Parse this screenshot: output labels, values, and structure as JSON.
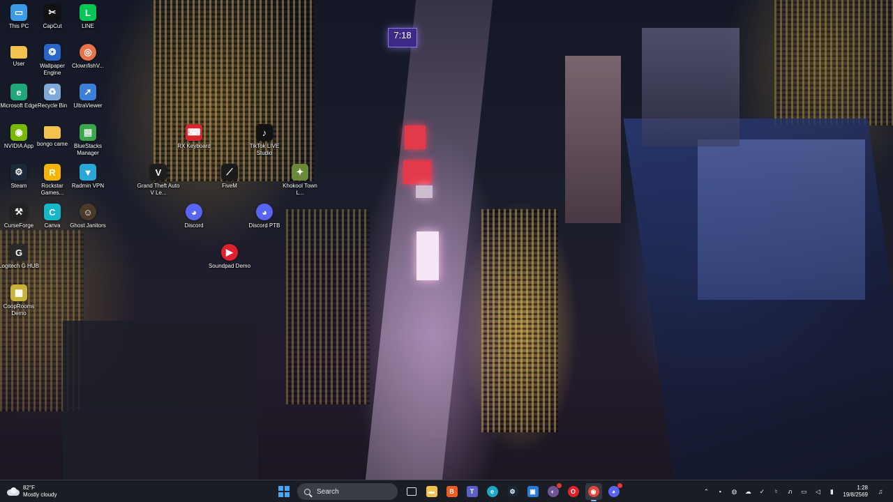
{
  "wallpaper": {
    "sign_time": "7:18"
  },
  "desktop_icons": [
    {
      "label": "This PC",
      "icon": "monitor-icon",
      "color": "#3a9be8",
      "glyph": "▭"
    },
    {
      "label": "User",
      "icon": "folder-icon",
      "color": "#f2c14e",
      "glyph": ""
    },
    {
      "label": "Microsoft Edge",
      "icon": "edge-icon",
      "color": "#1fa67a",
      "glyph": "e"
    },
    {
      "label": "NVIDIA App",
      "icon": "nvidia-icon",
      "color": "#76b900",
      "glyph": "◉"
    },
    {
      "label": "Steam",
      "icon": "steam-icon",
      "color": "#1b2838",
      "glyph": "⚙"
    },
    {
      "label": "CurseForge",
      "icon": "curseforge-icon",
      "color": "#222222",
      "glyph": "⚒"
    },
    {
      "label": "Logitech G HUB",
      "icon": "logitech-icon",
      "color": "#2a2a2a",
      "glyph": "G"
    },
    {
      "label": "CoopRooms Demo",
      "icon": "cooprooms-icon",
      "color": "#c9b23a",
      "glyph": "▦"
    },
    {
      "label": "CapCut",
      "icon": "capcut-icon",
      "color": "#111111",
      "glyph": "✂"
    },
    {
      "label": "Wallpaper Engine",
      "icon": "wallpaper-engine-icon",
      "color": "#2a66c8",
      "glyph": "❂"
    },
    {
      "label": "Recycle Bin",
      "icon": "recycle-bin-icon",
      "color": "#7fa9d8",
      "glyph": "♻"
    },
    {
      "label": "bongo came",
      "icon": "folder-icon",
      "color": "#f2c14e",
      "glyph": ""
    },
    {
      "label": "Rockstar Games...",
      "icon": "rockstar-icon",
      "color": "#f4b400",
      "glyph": "R"
    },
    {
      "label": "Canva",
      "icon": "canva-icon",
      "color": "#14b8c8",
      "glyph": "C"
    },
    {
      "label": "LINE",
      "icon": "line-icon",
      "color": "#06c755",
      "glyph": "L"
    },
    {
      "label": "ClownfishV...",
      "icon": "clownfish-icon",
      "color": "#e8734a",
      "glyph": "◎"
    },
    {
      "label": "UltraViewer",
      "icon": "ultraviewer-icon",
      "color": "#3d7fd6",
      "glyph": "➚"
    },
    {
      "label": "BlueStacks Manager",
      "icon": "bluestacks-icon",
      "color": "#3aa84a",
      "glyph": "▤"
    },
    {
      "label": "Radmin VPN",
      "icon": "radmin-vpn-icon",
      "color": "#29a8d8",
      "glyph": "▼"
    },
    {
      "label": "Ghost Janitors",
      "icon": "ghost-janitors-icon",
      "color": "#4a3a2a",
      "glyph": "☺"
    },
    {
      "label": "Grand Theft Auto V Le...",
      "icon": "gta-v-icon",
      "color": "#1d1d1d",
      "glyph": "V"
    },
    {
      "label": "RX Keyboard",
      "icon": "rx-keyboard-icon",
      "color": "#d8262e",
      "glyph": "⌨"
    },
    {
      "label": "FiveM",
      "icon": "fivem-icon",
      "color": "#1a1a1a",
      "glyph": "⟋"
    },
    {
      "label": "Discord",
      "icon": "discord-icon",
      "color": "#5865f2",
      "glyph": "◕"
    },
    {
      "label": "TikTok LIVE Studio",
      "icon": "tiktok-live-icon",
      "color": "#111111",
      "glyph": "♪"
    },
    {
      "label": "Khokool Town L...",
      "icon": "khokool-icon",
      "color": "#6a8a3a",
      "glyph": "✦"
    },
    {
      "label": "Discord PTB",
      "icon": "discord-ptb-icon",
      "color": "#5865f2",
      "glyph": "◕"
    },
    {
      "label": "Soundpad Demo",
      "icon": "soundpad-icon",
      "color": "#e0202c",
      "glyph": "▶"
    }
  ],
  "taskbar": {
    "weather_temp": "82°F",
    "weather_desc": "Mostly cloudy",
    "search_placeholder": "Search",
    "apps": [
      {
        "name": "file-explorer-button",
        "icon": "folder-icon",
        "color": "#f2c14e",
        "glyph": "▬",
        "active": false
      },
      {
        "name": "brave-button",
        "icon": "brave-icon",
        "color": "#f25a24",
        "glyph": "B",
        "active": false
      },
      {
        "name": "teams-button",
        "icon": "teams-icon",
        "color": "#5b5fc7",
        "glyph": "T",
        "active": false
      },
      {
        "name": "edge-button",
        "icon": "edge-icon",
        "color": "#1fa6c8",
        "glyph": "e",
        "active": false
      },
      {
        "name": "steam-button",
        "icon": "steam-icon",
        "color": "#1b2838",
        "glyph": "⚙",
        "active": false
      },
      {
        "name": "remote-desktop-button",
        "icon": "remote-desktop-icon",
        "color": "#2b7bd6",
        "glyph": "▣",
        "active": false
      },
      {
        "name": "github-desktop-button",
        "icon": "github-icon",
        "color": "#6e5494",
        "glyph": "◐",
        "active": false,
        "badge": true
      },
      {
        "name": "opera-button",
        "icon": "opera-icon",
        "color": "#e0202c",
        "glyph": "O",
        "active": false
      },
      {
        "name": "chrome-button",
        "icon": "chrome-icon",
        "color": "#e8453c",
        "glyph": "◉",
        "active": true
      },
      {
        "name": "discord-button",
        "icon": "discord-icon",
        "color": "#5865f2",
        "glyph": "◕",
        "active": false,
        "badge": true
      }
    ],
    "tray": [
      {
        "name": "show-hidden-icons",
        "icon": "chevron-up-icon",
        "glyph": "⌃"
      },
      {
        "name": "tray-app-1",
        "icon": "blue-square-icon",
        "glyph": "▪"
      },
      {
        "name": "tray-app-2",
        "icon": "edge-dev-icon",
        "glyph": "◍"
      },
      {
        "name": "tray-app-3",
        "icon": "onedrive-icon",
        "glyph": "☁"
      },
      {
        "name": "tray-app-4",
        "icon": "checkmark-icon",
        "glyph": "✓"
      },
      {
        "name": "tray-mic",
        "icon": "microphone-icon",
        "glyph": "♮"
      },
      {
        "name": "tray-language",
        "icon": "language-icon",
        "glyph": "ภ"
      },
      {
        "name": "tray-network",
        "icon": "network-icon",
        "glyph": "▭"
      },
      {
        "name": "tray-volume",
        "icon": "speaker-icon",
        "glyph": "◁"
      },
      {
        "name": "tray-battery",
        "icon": "battery-icon",
        "glyph": "▮"
      }
    ],
    "time": "1:28",
    "date": "19/8/2569"
  }
}
